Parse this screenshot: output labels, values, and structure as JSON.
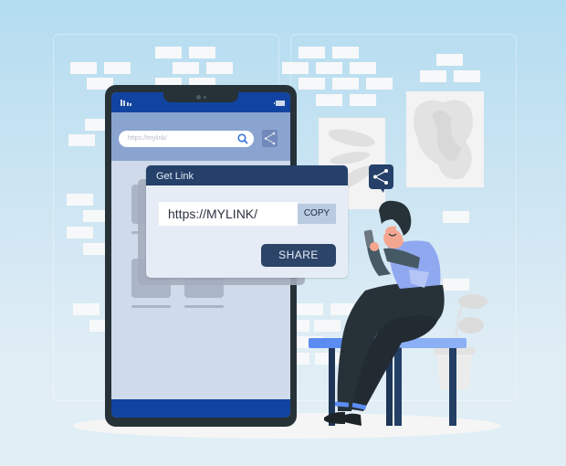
{
  "phone": {
    "url_bar_text": "https://mylink/",
    "icons": [
      "signal-icon",
      "battery-icon",
      "search-icon",
      "share-icon"
    ]
  },
  "dialog": {
    "title": "Get Link",
    "link_value": "https://MYLINK/",
    "copy_label": "COPY",
    "share_label": "SHARE"
  },
  "floating_icon": "share-icon",
  "colors": {
    "phone_frame": "#263238",
    "phone_status_bar": "#1144a0",
    "dialog_header": "#25416a",
    "share_button": "#2b4468",
    "copy_button": "#b8cbe1",
    "shirt": "#8fa8f0",
    "bench": "#7fa6f2"
  }
}
